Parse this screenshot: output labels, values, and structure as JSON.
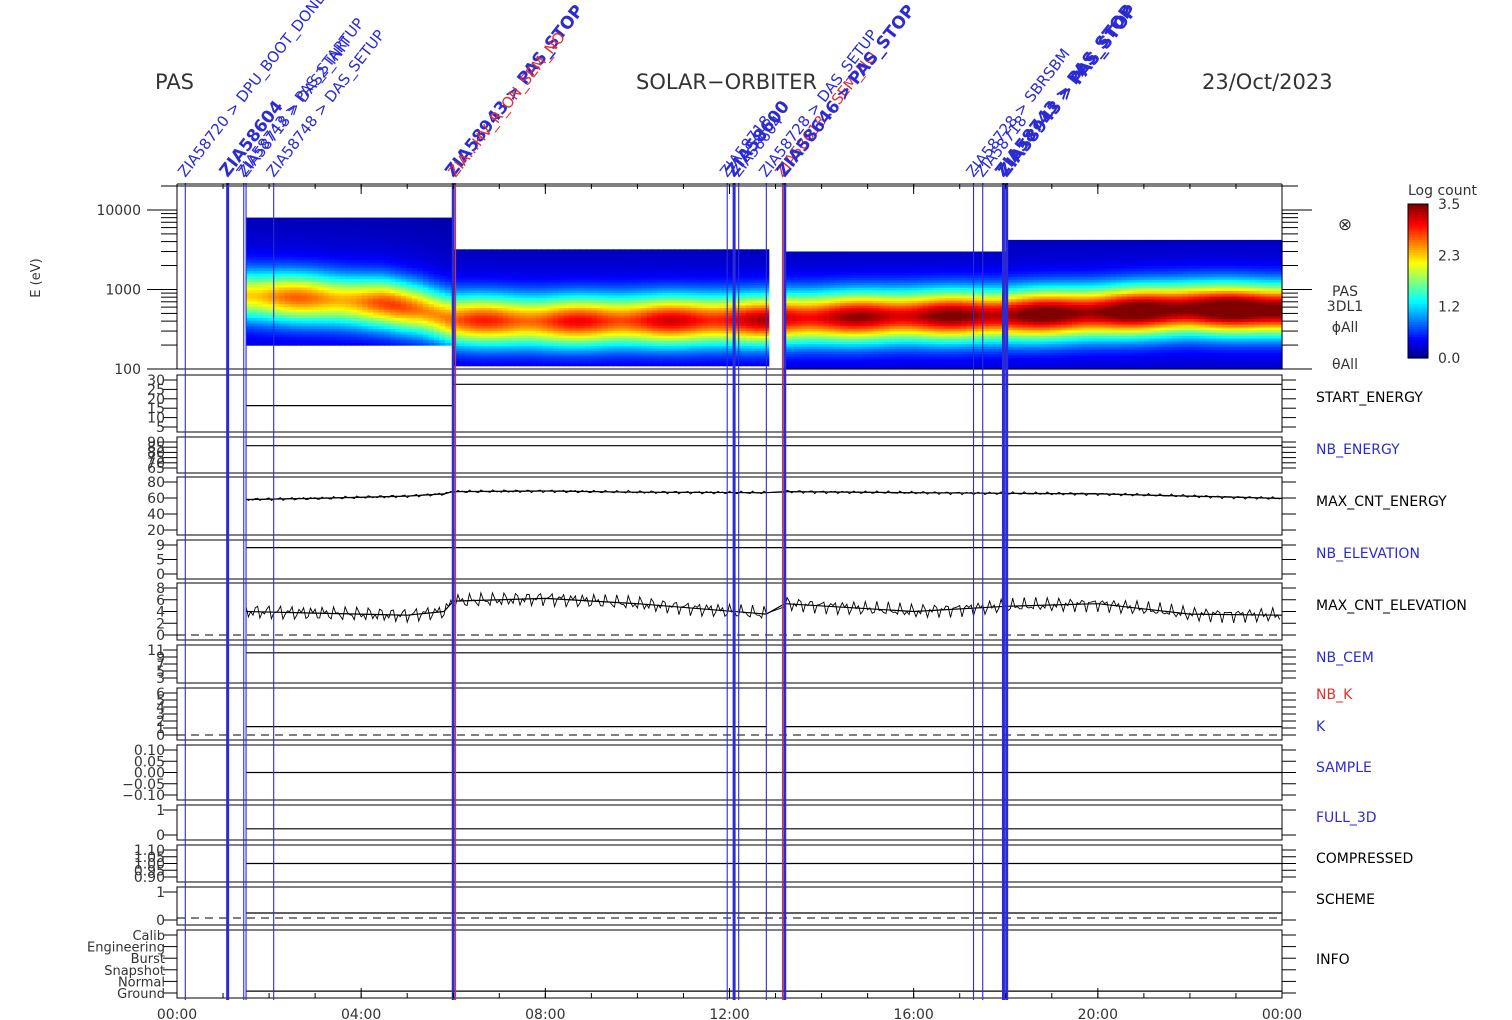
{
  "header": {
    "instrument": "PAS",
    "mission": "SOLAR−ORBITER",
    "date": "23/Oct/2023"
  },
  "colors": {
    "blue": "#2b2bd6",
    "red": "#e03030",
    "purple": "#9a2a8a",
    "black": "#000000"
  },
  "colorbar": {
    "title": "Log count",
    "ticks": [
      "3.5",
      "2.3",
      "1.2",
      "0.0"
    ],
    "range": [
      0.0,
      3.5
    ],
    "scale": "jet"
  },
  "chart_data": {
    "type": "heatmap",
    "title": "",
    "x_axis": {
      "range_hours": [
        0,
        24
      ],
      "ticks": [
        "00:00",
        "04:00",
        "08:00",
        "12:00",
        "16:00",
        "20:00",
        "00:00"
      ]
    },
    "spectrogram": {
      "ylabel": "E (eV)",
      "yscale": "log",
      "ylim": [
        100,
        20000
      ],
      "yticks": [
        "10000",
        "1000",
        "100"
      ],
      "right_labels": [
        "⊗",
        "PAS",
        "3DL1",
        "ϕAll",
        "θAll"
      ],
      "peak_energy_ev": [
        {
          "t": 1.5,
          "e": 850
        },
        {
          "t": 3.0,
          "e": 780
        },
        {
          "t": 4.5,
          "e": 680
        },
        {
          "t": 5.3,
          "e": 560
        },
        {
          "t": 6.0,
          "e": 420
        },
        {
          "t": 8.0,
          "e": 400
        },
        {
          "t": 10.0,
          "e": 410
        },
        {
          "t": 12.8,
          "e": 420
        },
        {
          "t": 13.2,
          "e": 440
        },
        {
          "t": 16.0,
          "e": 470
        },
        {
          "t": 18.0,
          "e": 480
        },
        {
          "t": 20.0,
          "e": 520
        },
        {
          "t": 22.0,
          "e": 580
        },
        {
          "t": 24.0,
          "e": 560
        }
      ],
      "segments": [
        {
          "start": 1.5,
          "end": 6.0,
          "emin": 200,
          "emax": 8000
        },
        {
          "start": 6.0,
          "end": 12.85,
          "emin": 110,
          "emax": 3200
        },
        {
          "start": 13.2,
          "end": 18.0,
          "emin": 100,
          "emax": 3000
        },
        {
          "start": 18.0,
          "end": 24.0,
          "emin": 100,
          "emax": 4200
        }
      ],
      "gap": [
        12.85,
        13.2
      ]
    },
    "panels": [
      {
        "label": "START_ENERGY",
        "label_color": "black",
        "ticks": [
          "30",
          "25",
          "20",
          "15",
          "10",
          "5"
        ],
        "range": [
          0,
          33
        ],
        "series": [
          {
            "t": [
              1.5,
              6.0
            ],
            "v": [
              15,
              15
            ]
          },
          {
            "t": [
              6.0,
              24.0
            ],
            "v": [
              30,
              30
            ]
          }
        ]
      },
      {
        "label": "NB_ENERGY",
        "label_color": "blue",
        "ticks": [
          "90",
          "85",
          "80",
          "75",
          "70",
          "65"
        ],
        "range": [
          60,
          95
        ],
        "series": [
          {
            "t": [
              1.5,
              24.0
            ],
            "v": [
              90,
              90
            ]
          }
        ]
      },
      {
        "label": "MAX_CNT_ENERGY",
        "label_color": "black",
        "ticks": [
          "80",
          "60",
          "40",
          "20"
        ],
        "range": [
          0,
          85
        ],
        "series": [
          {
            "t": [
              1.5,
              3.0,
              5.0,
              5.8,
              6.0,
              8.0,
              10.0,
              12.8,
              13.2,
              16.0,
              18.0,
              20.0,
              22.0,
              24.0
            ],
            "v": [
              54,
              56,
              60,
              64,
              68,
              69,
              67,
              66,
              68,
              66,
              65,
              64,
              60,
              56
            ]
          }
        ]
      },
      {
        "label": "NB_ELEVATION",
        "label_color": "blue",
        "ticks": [
          "9",
          "5",
          "0"
        ],
        "range": [
          -1,
          10
        ],
        "series": [
          {
            "t": [
              1.5,
              24.0
            ],
            "v": [
              9,
              9
            ]
          }
        ]
      },
      {
        "label": "MAX_CNT_ELEVATION",
        "label_color": "black",
        "ticks": [
          "8",
          "6",
          "4",
          "2",
          "0"
        ],
        "range": [
          0,
          9
        ],
        "series": [
          {
            "t": [
              1.5,
              3.0,
              5.0,
              5.8,
              6.0,
              8.0,
              10.0,
              12.8,
              13.2,
              16.0,
              18.0,
              20.0,
              22.0,
              24.0
            ],
            "v": [
              4.5,
              4.2,
              3.8,
              4.5,
              6.5,
              7.0,
              6.0,
              4.0,
              6.0,
              4.5,
              5.5,
              6.0,
              4.0,
              3.8
            ]
          }
        ]
      },
      {
        "label": "NB_CEM",
        "label_color": "blue",
        "ticks": [
          "11",
          "9",
          "7",
          "5",
          "3"
        ],
        "range": [
          2,
          12
        ],
        "series": [
          {
            "t": [
              1.5,
              24.0
            ],
            "v": [
              11,
              11
            ]
          }
        ]
      },
      {
        "label": "NB_K",
        "label_color": "red",
        "ticks": [
          "6",
          "5",
          "4",
          "3",
          "2",
          "1",
          "0"
        ],
        "range": [
          -0.5,
          7
        ],
        "series": [
          {
            "t": [
              1.5,
              12.8
            ],
            "v": [
              1,
              1
            ]
          },
          {
            "t": [
              13.2,
              24.0
            ],
            "v": [
              1,
              1
            ]
          }
        ]
      },
      {
        "label": "SAMPLE",
        "label_color": "blue",
        "ticks": [
          "0.10",
          "0.05",
          "0.00",
          "−0.05",
          "−0.10"
        ],
        "range": [
          -0.12,
          0.12
        ],
        "series": [
          {
            "t": [
              1.5,
              24.0
            ],
            "v": [
              0.0,
              0.0
            ]
          }
        ]
      },
      {
        "label": "FULL_3D",
        "label_color": "blue",
        "ticks": [
          "1",
          "0"
        ],
        "range": [
          -0.5,
          1.5
        ],
        "series": [
          {
            "t": [
              1.5,
              24.0
            ],
            "v": [
              0,
              0
            ]
          }
        ]
      },
      {
        "label": "COMPRESSED",
        "label_color": "black",
        "ticks": [
          "1.10",
          "1.05",
          "1.00",
          "0.95",
          "0.90"
        ],
        "range": [
          0.88,
          1.12
        ],
        "series": [
          {
            "t": [
              1.5,
              24.0
            ],
            "v": [
              1.0,
              1.0
            ]
          }
        ]
      },
      {
        "label": "SCHEME",
        "label_color": "black",
        "ticks": [
          "1",
          "0"
        ],
        "range": [
          -0.5,
          1.5
        ],
        "series": [
          {
            "t": [
              1.5,
              24.0
            ],
            "v": [
              0,
              0
            ]
          }
        ]
      },
      {
        "label": "INFO",
        "label_color": "black",
        "ticks": [
          "Calib",
          "Engineering",
          "Burst",
          "Snapshot",
          "Normal",
          "Ground"
        ],
        "range": [
          0,
          6
        ],
        "series": [
          {
            "t": [
              1.5,
              24.0
            ],
            "v": [
              0.2,
              0.2
            ]
          }
        ]
      }
    ],
    "K_label": "K",
    "events": [
      {
        "t": 0.18,
        "label": "ZIA58720 > DPU_BOOT_DONE",
        "color": "blue",
        "bold": false
      },
      {
        "t": 1.1,
        "label": "ZIA58604",
        "color": "blue",
        "bold": true
      },
      {
        "t": 1.45,
        "label": "ZIA58743 > PAS_STARTUP",
        "color": "blue",
        "bold": false
      },
      {
        "t": 1.5,
        "label": "ZIA58718 > DAS2_INIT",
        "color": "blue",
        "bold": false
      },
      {
        "t": 2.1,
        "label": "ZIA58748 > DAS_SETUP",
        "color": "blue",
        "bold": false
      },
      {
        "t": 6.0,
        "label": "ZIA58943 > PAS_STOP",
        "color": "blue",
        "bold": true
      },
      {
        "t": 6.05,
        "label": "ZIA...HV_R_ON_SEM_NO",
        "color": "red",
        "bold": false
      },
      {
        "t": 11.95,
        "label": "ZIA58718",
        "color": "blue",
        "bold": false
      },
      {
        "t": 12.1,
        "label": "ZIA58600",
        "color": "blue",
        "bold": true
      },
      {
        "t": 12.2,
        "label": "ZIA58604",
        "color": "blue",
        "bold": false
      },
      {
        "t": 12.8,
        "label": "ZIA58728 > DAS_SETUP",
        "color": "blue",
        "bold": false
      },
      {
        "t": 13.15,
        "label": "ZIA58618 ...SEM_NO",
        "color": "red",
        "bold": false
      },
      {
        "t": 13.2,
        "label": "ZIA58646 > PAS_STOP",
        "color": "blue",
        "bold": true
      },
      {
        "t": 17.3,
        "label": "ZIA58728 > SBRSBM",
        "color": "blue",
        "bold": false
      },
      {
        "t": 17.5,
        "label": "ZIA58718",
        "color": "blue",
        "bold": false
      },
      {
        "t": 17.95,
        "label": "ZIA58743 > PAS_STOP",
        "color": "blue",
        "bold": true
      },
      {
        "t": 18.02,
        "label": "ZIA58943 > PAS_STOP",
        "color": "blue",
        "bold": true
      }
    ]
  }
}
